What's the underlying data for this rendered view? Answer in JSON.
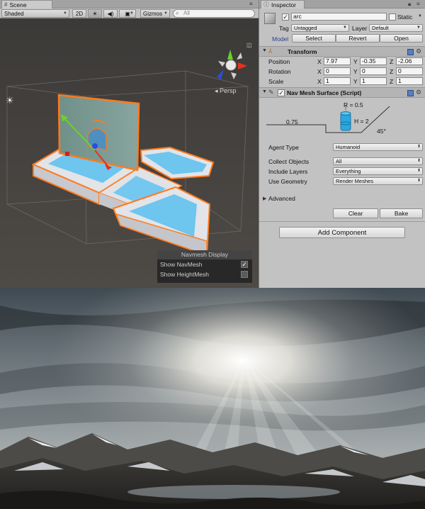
{
  "scene": {
    "tab_label": "Scene",
    "shading_mode": "Shaded",
    "mode_2d": "2D",
    "gizmos_label": "Gizmos",
    "search_placeholder": "All",
    "persp_label": "Persp",
    "navmesh_display": {
      "title": "Navmesh Display",
      "show_navmesh_label": "Show NavMesh",
      "show_navmesh_checked": true,
      "show_heightmesh_label": "Show HeightMesh",
      "show_heightmesh_checked": false
    },
    "colors": {
      "navmesh": "#69c4ee",
      "selection_outline": "#ff7a1c",
      "wall": "#7a9a92"
    }
  },
  "inspector": {
    "tab_label": "Inspector",
    "object_name": "arc",
    "object_active": true,
    "static_label": "Static",
    "tag_label": "Tag",
    "tag_value": "Untagged",
    "layer_label": "Layer",
    "layer_value": "Default",
    "model_label": "Model",
    "model_buttons": {
      "select": "Select",
      "revert": "Revert",
      "open": "Open"
    },
    "transform": {
      "title": "Transform",
      "position_label": "Position",
      "rotation_label": "Rotation",
      "scale_label": "Scale",
      "axis_x": "X",
      "axis_y": "Y",
      "axis_z": "Z",
      "position": {
        "x": "7.97",
        "y": "-0.35",
        "z": "-2.06"
      },
      "rotation": {
        "x": "0",
        "y": "0",
        "z": "0"
      },
      "scale": {
        "x": "1",
        "y": "1",
        "z": "1"
      }
    },
    "navmesh_surface": {
      "title": "Nav Mesh Surface (Script)",
      "enabled": true,
      "diagram": {
        "radius": "R = 0.5",
        "height": "H = 2",
        "step": "0.75",
        "slope": "45°"
      },
      "agent_type_label": "Agent Type",
      "agent_type_value": "Humanoid",
      "collect_objects_label": "Collect Objects",
      "collect_objects_value": "All",
      "include_layers_label": "Include Layers",
      "include_layers_value": "Everything",
      "use_geometry_label": "Use Geometry",
      "use_geometry_value": "Render Meshes",
      "advanced_label": "Advanced",
      "clear_button": "Clear",
      "bake_button": "Bake"
    },
    "add_component_button": "Add Component"
  }
}
